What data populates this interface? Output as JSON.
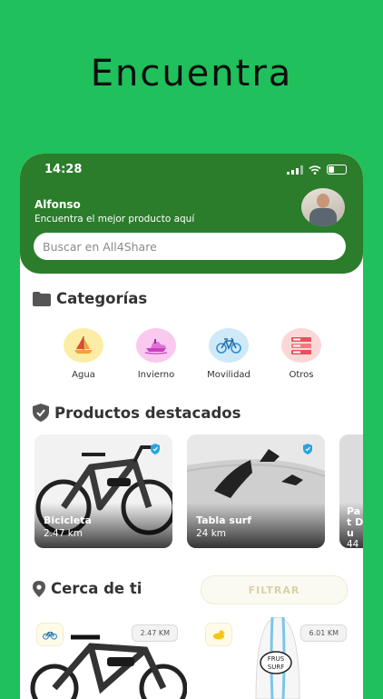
{
  "headline": "Encuentra",
  "status": {
    "time": "14:28"
  },
  "user": {
    "name": "Alfonso",
    "subtitle": "Encuentra el mejor producto aquí"
  },
  "search": {
    "placeholder": "Buscar en All4Share"
  },
  "categories": {
    "title": "Categorías",
    "items": [
      {
        "label": "Agua",
        "icon": "sailboat-icon",
        "color": "#fbeea4"
      },
      {
        "label": "Invierno",
        "icon": "jetski-icon",
        "color": "#f9c9ef"
      },
      {
        "label": "Movilidad",
        "icon": "bicycle-icon",
        "color": "#cfe9f8"
      },
      {
        "label": "Otros",
        "icon": "list-icon",
        "color": "#fcd7d8"
      }
    ]
  },
  "featured": {
    "title": "Productos destacados",
    "items": [
      {
        "name": "Bicicleta",
        "distance": "2.47 km"
      },
      {
        "name": "Tabla surf",
        "distance": "24 km"
      },
      {
        "name": "Pat Du",
        "distance": "44"
      }
    ]
  },
  "nearby": {
    "title": "Cerca de ti",
    "filter_label": "FILTRAR",
    "items": [
      {
        "distance": "2.47 KM",
        "icon": "bicycle-icon"
      },
      {
        "distance": "6.01 KM",
        "icon": "duck-icon"
      }
    ]
  },
  "colors": {
    "background": "#20c05c",
    "header": "#2b7d2b"
  }
}
